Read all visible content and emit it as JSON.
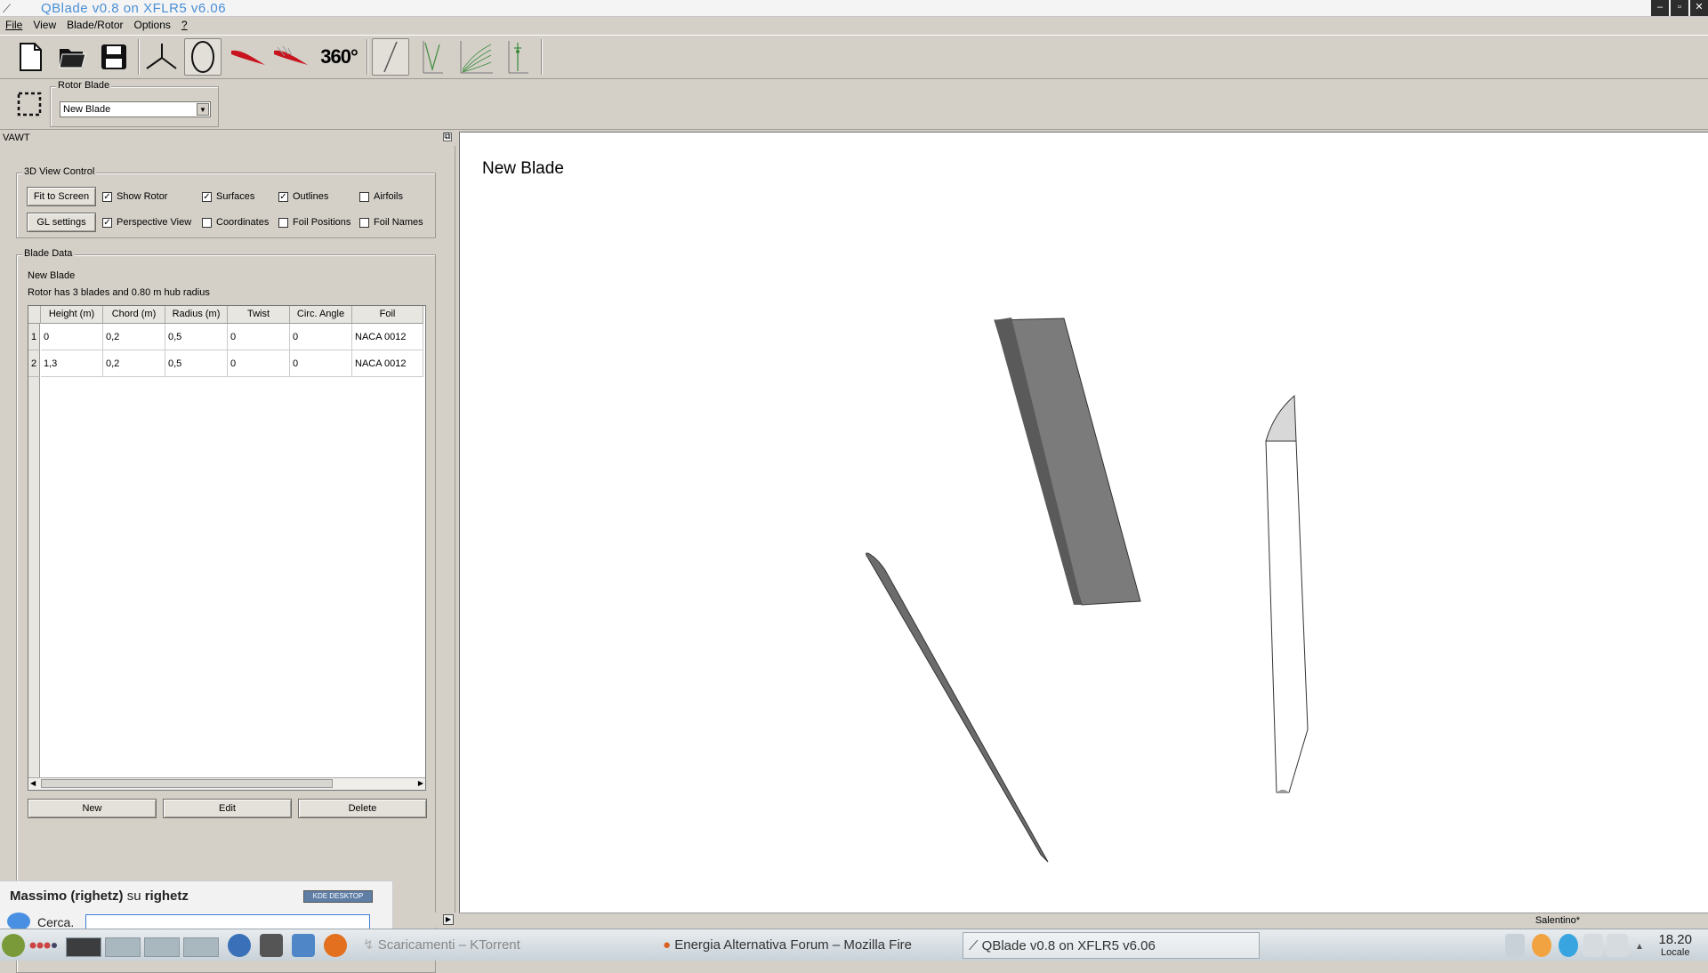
{
  "window": {
    "title": "QBlade  v0.8  on  XFLR5  v6.06"
  },
  "menu": [
    "File",
    "View",
    "Blade/Rotor",
    "Options",
    "?"
  ],
  "toolbar": {
    "label_360": "360°"
  },
  "rotor_blade_group": {
    "label": "Rotor Blade",
    "selected": "New Blade"
  },
  "dock": {
    "title": "VAWT"
  },
  "view_control": {
    "label": "3D View Control",
    "fit_to_screen": "Fit to Screen",
    "gl_settings": "GL settings",
    "checks": [
      {
        "label": "Show Rotor",
        "checked": true
      },
      {
        "label": "Surfaces",
        "checked": true
      },
      {
        "label": "Outlines",
        "checked": true
      },
      {
        "label": "Airfoils",
        "checked": false
      },
      {
        "label": "Perspective View",
        "checked": true
      },
      {
        "label": "Coordinates",
        "checked": false
      },
      {
        "label": "Foil Positions",
        "checked": false
      },
      {
        "label": "Foil Names",
        "checked": false
      }
    ]
  },
  "blade_data": {
    "label": "Blade Data",
    "name": "New Blade",
    "description": "Rotor has 3 blades and 0.80 m hub radius",
    "columns": [
      "Height (m)",
      "Chord (m)",
      "Radius (m)",
      "Twist",
      "Circ. Angle",
      "Foil"
    ],
    "rows": [
      {
        "index": "1",
        "cells": [
          "0",
          "0,2",
          "0,5",
          "0",
          "0",
          "NACA 0012"
        ]
      },
      {
        "index": "2",
        "cells": [
          "1,3",
          "0,2",
          "0,5",
          "0",
          "0",
          "NACA 0012"
        ]
      }
    ],
    "buttons": {
      "new": "New",
      "edit": "Edit",
      "delete": "Delete"
    }
  },
  "viewport": {
    "title": "New Blade"
  },
  "statusbar": {
    "text": "Salentino*"
  },
  "kicker": {
    "user": "Massimo (righetz)",
    "su": "su",
    "host": "righetz",
    "kde_badge": "KDE DESKTOP",
    "search_label": "Cerca."
  },
  "taskbar": {
    "tasks": [
      "Scaricamenti – KTorrent",
      "Energia Alternativa Forum – Mozilla Fire",
      "QBlade  v0.8  on  XFLR5  v6.06"
    ],
    "clock_time": "18.20",
    "clock_zone": "Locale"
  }
}
